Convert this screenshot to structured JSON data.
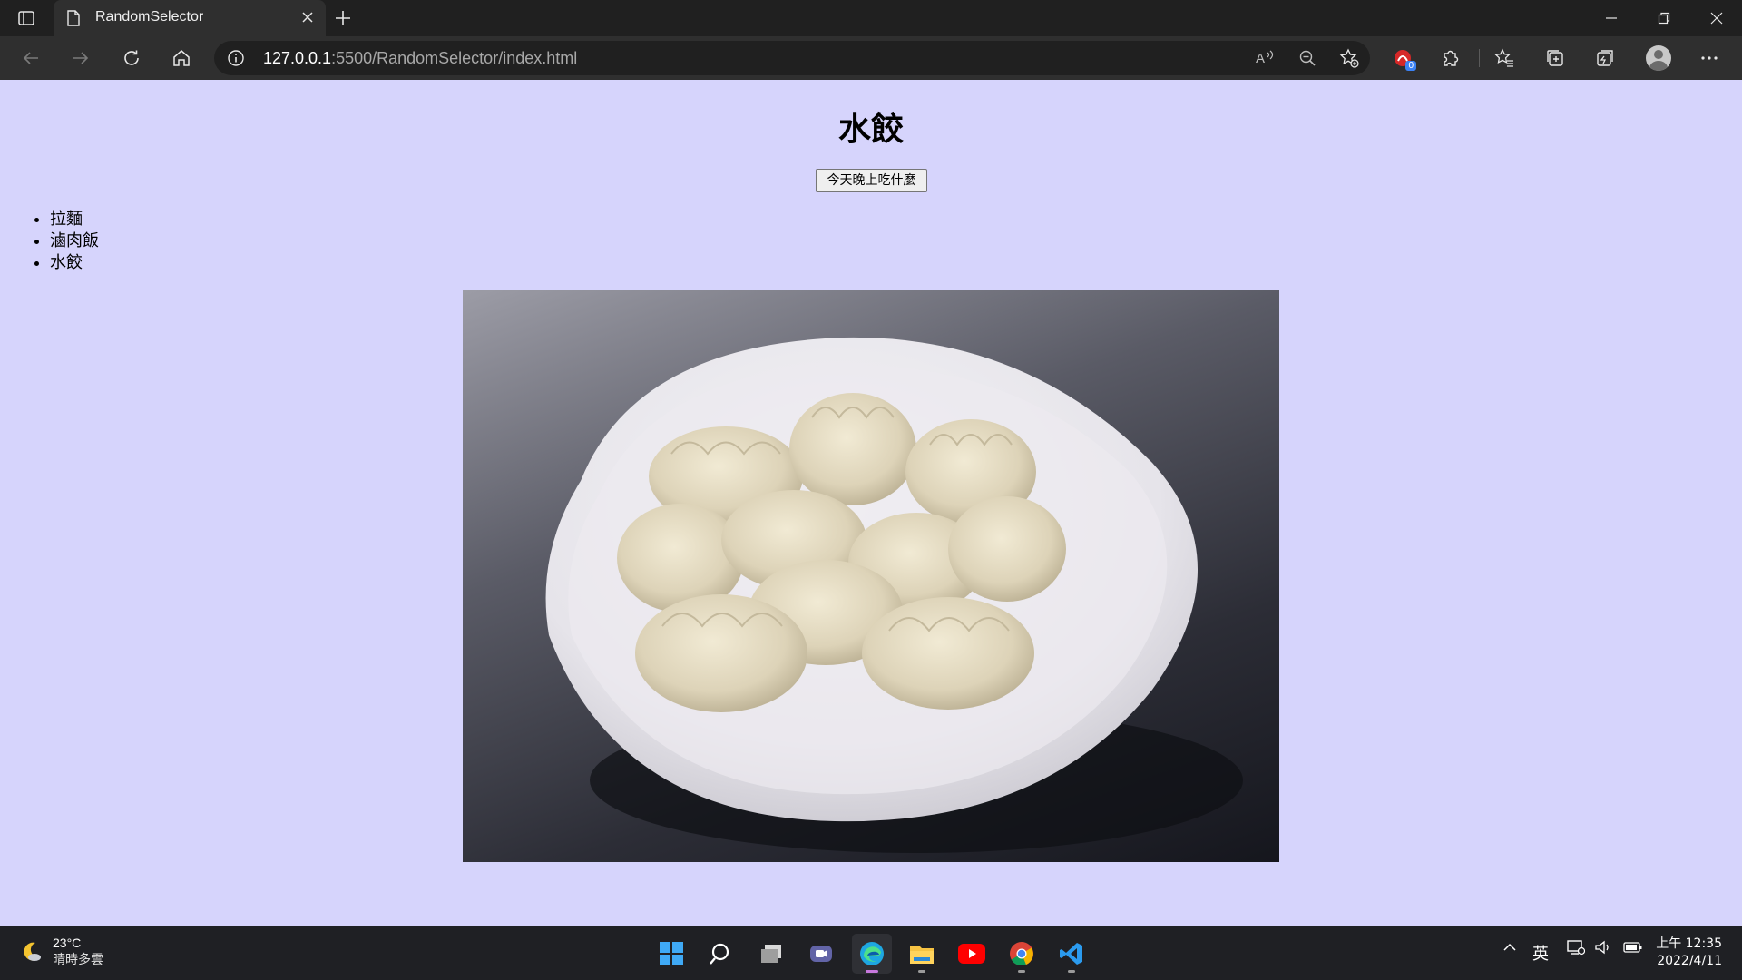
{
  "browser": {
    "tab_title": "RandomSelector",
    "url_host": "127.0.0.1",
    "url_path": ":5500/RandomSelector/index.html",
    "extension_badge": "0"
  },
  "page": {
    "heading": "水餃",
    "button_label": "今天晚上吃什麼",
    "food_items": [
      "拉麵",
      "滷肉飯",
      "水餃"
    ],
    "background_color": "#d6d4fc"
  },
  "taskbar": {
    "weather_temp": "23°C",
    "weather_desc": "晴時多雲",
    "input_method": "英",
    "time": "上午 12:35",
    "date": "2022/4/11"
  }
}
